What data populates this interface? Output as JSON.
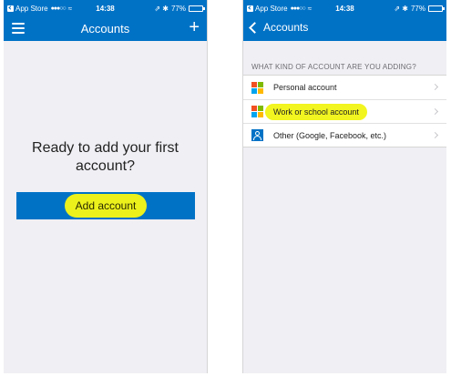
{
  "left_screen": {
    "status": {
      "carrier": "App Store",
      "signal": "●●●○○",
      "wifi": "≈",
      "time": "14:38",
      "icons": "⇗ ✱",
      "battery": "77%"
    },
    "nav": {
      "title": "Accounts",
      "menu_icon": "hamburger-menu-icon",
      "add_icon": "plus-icon",
      "add_glyph": "+"
    },
    "ready_text": "Ready to add your first account?",
    "add_button_label": "Add account",
    "highlight_color": "#ecf11c"
  },
  "right_screen": {
    "status": {
      "carrier": "App Store",
      "signal": "●●●○○",
      "wifi": "≈",
      "time": "14:38",
      "icons": "⇗ ✱",
      "battery": "77%"
    },
    "nav": {
      "back_label": "Accounts",
      "back_icon": "chevron-left-icon"
    },
    "section_header": "WHAT KIND OF ACCOUNT ARE YOU ADDING?",
    "items": [
      {
        "label": "Personal account",
        "icon": "microsoft-logo-icon"
      },
      {
        "label": "Work or school account",
        "icon": "microsoft-logo-icon",
        "highlighted": true
      },
      {
        "label": "Other (Google, Facebook, etc.)",
        "icon": "person-icon"
      }
    ]
  },
  "colors": {
    "brand_blue": "#0072c6",
    "background": "#efeff4",
    "highlight": "#ecf11c"
  }
}
